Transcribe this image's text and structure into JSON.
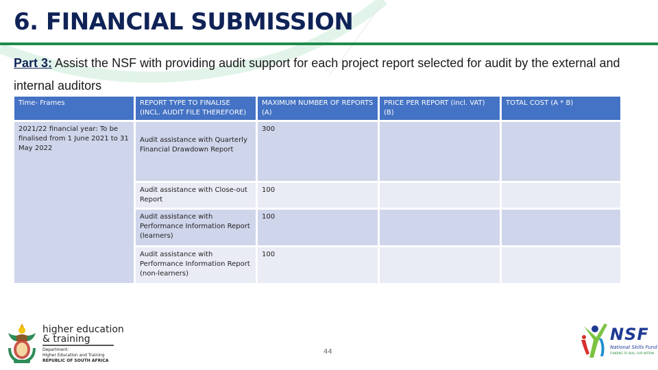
{
  "slide": {
    "title": "6. FINANCIAL SUBMISSION",
    "intro_lead": "Part 3:",
    "intro_text": " Assist the NSF with providing audit support for each project report selected for audit by the external and internal auditors",
    "page_number": "44"
  },
  "table": {
    "headers": [
      "Time- Frames",
      "REPORT TYPE TO FINALISE (INCL. AUDIT FILE THEREFORE)",
      "MAXIMUM NUMBER OF REPORTS (A)",
      "PRICE PER REPORT (incl. VAT) (B)",
      "TOTAL COST (A * B)"
    ],
    "timeframe": "2021/22 financial year: To be finalised from 1 June 2021 to 31 May 2022",
    "rows": [
      {
        "report_type": "Audit assistance with Quarterly Financial Drawdown Report",
        "max_reports": "300",
        "price": "",
        "total": ""
      },
      {
        "report_type": "Audit assistance with Close-out Report",
        "max_reports": "100",
        "price": "",
        "total": ""
      },
      {
        "report_type": "Audit assistance with Performance Information Report (learners)",
        "max_reports": "100",
        "price": "",
        "total": ""
      },
      {
        "report_type": "Audit assistance with Performance Information Report (non-learners)",
        "max_reports": "100",
        "price": "",
        "total": ""
      }
    ]
  },
  "logos": {
    "dhet": {
      "line1": "higher education",
      "line2": "& training",
      "dept_label": "Department:",
      "dept_name": "Higher Education and Training",
      "country": "REPUBLIC OF SOUTH AFRICA"
    },
    "nsf": {
      "name": "NSF",
      "subtitle": "National Skills Fund",
      "tagline": "FUNDING TO SKILL OUR NATION"
    }
  },
  "colors": {
    "title": "#0f2357",
    "rule": "#1e8a4c",
    "header_bg": "#4472c4",
    "row_dark": "#cfd5ea",
    "row_light": "#e9ebf5"
  }
}
